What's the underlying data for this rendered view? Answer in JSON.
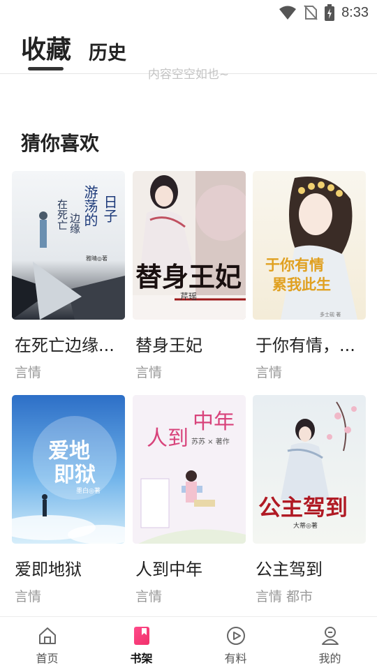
{
  "status": {
    "time": "8:33",
    "icons": [
      "wifi-icon",
      "no-sim-icon",
      "battery-charging-icon"
    ]
  },
  "header": {
    "tabs": [
      {
        "label": "收藏",
        "active": true
      },
      {
        "label": "历史",
        "active": false
      }
    ],
    "empty_hint": "内容空空如也~"
  },
  "recommend": {
    "title": "猜你喜欢",
    "books": [
      {
        "title": "在死亡边缘游荡的日子",
        "display_title": "在死亡边缘...",
        "tags": "言情",
        "cover_text": [
          "在死亡",
          "边缘",
          "游荡的",
          "日子"
        ],
        "cover_author": "雅晴◎著"
      },
      {
        "title": "替身王妃",
        "display_title": "替身王妃",
        "tags": "言情",
        "cover_text": [
          "替身王妃"
        ],
        "cover_author": "芹瑶"
      },
      {
        "title": "于你有情，累我此生",
        "display_title": "于你有情，...",
        "tags": "言情",
        "cover_text": [
          "于你有情",
          "累我此生"
        ],
        "cover_author": "多士砚 著"
      },
      {
        "title": "爱即地狱",
        "display_title": "爱即地狱",
        "tags": "言情",
        "cover_text": [
          "爱地",
          "即狱"
        ],
        "cover_author": "墨白◎著"
      },
      {
        "title": "人到中年",
        "display_title": "人到中年",
        "tags": "言情",
        "cover_text": [
          "人到",
          "中年"
        ],
        "cover_author": "苏苏 × 著作"
      },
      {
        "title": "公主驾到",
        "display_title": "公主驾到",
        "tags": "言情 都市",
        "cover_text": [
          "公主驾到"
        ],
        "cover_author": "大蒂◎著"
      }
    ]
  },
  "bottom_nav": {
    "items": [
      {
        "label": "首页",
        "icon": "home-icon",
        "active": false
      },
      {
        "label": "书架",
        "icon": "bookshelf-icon",
        "active": true
      },
      {
        "label": "有料",
        "icon": "play-icon",
        "active": false
      },
      {
        "label": "我的",
        "icon": "profile-icon",
        "active": false
      }
    ]
  },
  "colors": {
    "accent": "#f0406c",
    "text_primary": "#222222",
    "text_secondary": "#999999"
  }
}
